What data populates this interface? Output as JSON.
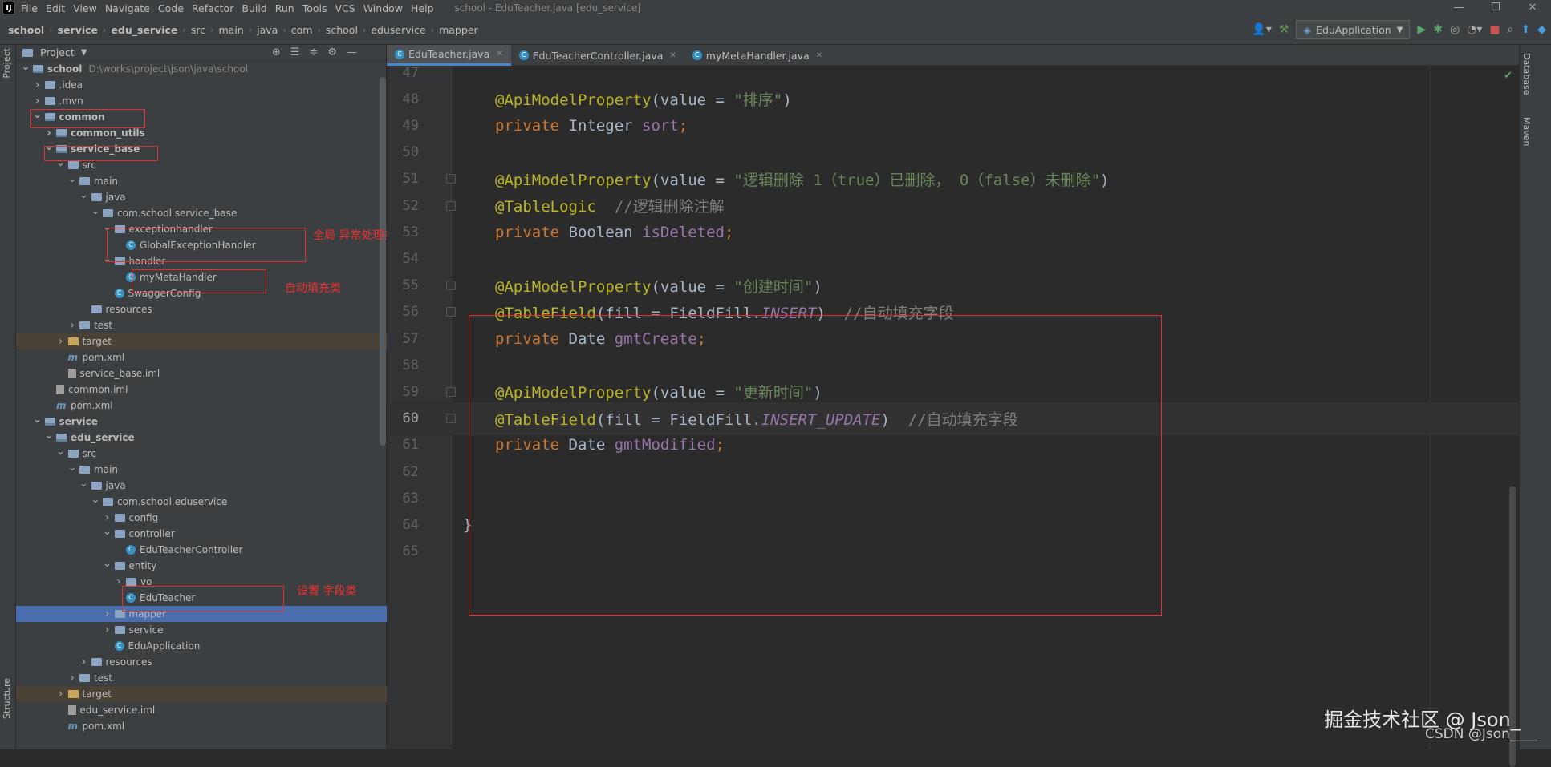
{
  "menubar": {
    "logo": "IJ",
    "items": [
      "File",
      "Edit",
      "View",
      "Navigate",
      "Code",
      "Refactor",
      "Build",
      "Run",
      "Tools",
      "VCS",
      "Window",
      "Help"
    ],
    "title": "school - EduTeacher.java [edu_service]",
    "controls": [
      "—",
      "❐",
      "✕"
    ]
  },
  "breadcrumb": [
    "school",
    "service",
    "edu_service",
    "src",
    "main",
    "java",
    "com",
    "school",
    "eduservice",
    "mapper"
  ],
  "toolbar": {
    "run_config": "EduApplication"
  },
  "leftstrip": {
    "project": "Project",
    "structure": "Structure"
  },
  "rightstrip": {
    "database": "Database",
    "maven": "Maven"
  },
  "project": {
    "title": "Project",
    "tree": [
      {
        "label": "school",
        "path": "D:\\works\\project\\json\\java\\school",
        "depth": 0,
        "arrow": "v",
        "icon": "module",
        "bold": true
      },
      {
        "label": ".idea",
        "depth": 1,
        "arrow": ">",
        "icon": "folder"
      },
      {
        "label": ".mvn",
        "depth": 1,
        "arrow": ">",
        "icon": "folder"
      },
      {
        "label": "common",
        "depth": 1,
        "arrow": "v",
        "icon": "module",
        "bold": true
      },
      {
        "label": "common_utils",
        "depth": 2,
        "arrow": ">",
        "icon": "module",
        "bold": true
      },
      {
        "label": "service_base",
        "depth": 2,
        "arrow": "v",
        "icon": "module",
        "bold": true
      },
      {
        "label": "src",
        "depth": 3,
        "arrow": "v",
        "icon": "folder"
      },
      {
        "label": "main",
        "depth": 4,
        "arrow": "v",
        "icon": "folder"
      },
      {
        "label": "java",
        "depth": 5,
        "arrow": "v",
        "icon": "folder"
      },
      {
        "label": "com.school.service_base",
        "depth": 6,
        "arrow": "v",
        "icon": "folder"
      },
      {
        "label": "exceptionhandler",
        "depth": 7,
        "arrow": "v",
        "icon": "folder"
      },
      {
        "label": "GlobalExceptionHandler",
        "depth": 8,
        "arrow": "",
        "icon": "class"
      },
      {
        "label": "handler",
        "depth": 7,
        "arrow": "v",
        "icon": "folder"
      },
      {
        "label": "myMetaHandler",
        "depth": 8,
        "arrow": "",
        "icon": "class"
      },
      {
        "label": "SwaggerConfig",
        "depth": 7,
        "arrow": "",
        "icon": "class"
      },
      {
        "label": "resources",
        "depth": 5,
        "arrow": "",
        "icon": "folder"
      },
      {
        "label": "test",
        "depth": 4,
        "arrow": ">",
        "icon": "folder"
      },
      {
        "label": "target",
        "depth": 3,
        "arrow": ">",
        "icon": "folder-orange",
        "excluded": true
      },
      {
        "label": "pom.xml",
        "depth": 3,
        "arrow": "",
        "icon": "maven"
      },
      {
        "label": "service_base.iml",
        "depth": 3,
        "arrow": "",
        "icon": "iml"
      },
      {
        "label": "common.iml",
        "depth": 2,
        "arrow": "",
        "icon": "iml"
      },
      {
        "label": "pom.xml",
        "depth": 2,
        "arrow": "",
        "icon": "maven"
      },
      {
        "label": "service",
        "depth": 1,
        "arrow": "v",
        "icon": "module",
        "bold": true
      },
      {
        "label": "edu_service",
        "depth": 2,
        "arrow": "v",
        "icon": "module",
        "bold": true
      },
      {
        "label": "src",
        "depth": 3,
        "arrow": "v",
        "icon": "folder"
      },
      {
        "label": "main",
        "depth": 4,
        "arrow": "v",
        "icon": "folder"
      },
      {
        "label": "java",
        "depth": 5,
        "arrow": "v",
        "icon": "folder"
      },
      {
        "label": "com.school.eduservice",
        "depth": 6,
        "arrow": "v",
        "icon": "folder"
      },
      {
        "label": "config",
        "depth": 7,
        "arrow": ">",
        "icon": "folder"
      },
      {
        "label": "controller",
        "depth": 7,
        "arrow": "v",
        "icon": "folder"
      },
      {
        "label": "EduTeacherController",
        "depth": 8,
        "arrow": "",
        "icon": "class"
      },
      {
        "label": "entity",
        "depth": 7,
        "arrow": "v",
        "icon": "folder"
      },
      {
        "label": "vo",
        "depth": 8,
        "arrow": ">",
        "icon": "folder"
      },
      {
        "label": "EduTeacher",
        "depth": 8,
        "arrow": "",
        "icon": "class"
      },
      {
        "label": "mapper",
        "depth": 7,
        "arrow": ">",
        "icon": "folder",
        "selected": true
      },
      {
        "label": "service",
        "depth": 7,
        "arrow": ">",
        "icon": "folder"
      },
      {
        "label": "EduApplication",
        "depth": 7,
        "arrow": "",
        "icon": "class"
      },
      {
        "label": "resources",
        "depth": 5,
        "arrow": ">",
        "icon": "folder"
      },
      {
        "label": "test",
        "depth": 4,
        "arrow": ">",
        "icon": "folder"
      },
      {
        "label": "target",
        "depth": 3,
        "arrow": ">",
        "icon": "folder-orange",
        "excluded": true
      },
      {
        "label": "edu_service.iml",
        "depth": 3,
        "arrow": "",
        "icon": "iml"
      },
      {
        "label": "pom.xml",
        "depth": 3,
        "arrow": "",
        "icon": "maven"
      }
    ]
  },
  "annotations": {
    "global_exception": "全局 异常处理类",
    "auto_fill": "自动填充类",
    "set_field": "设置 字段类"
  },
  "tabs": [
    "EduTeacher.java",
    "EduTeacherController.java",
    "myMetaHandler.java"
  ],
  "editor": {
    "current_line": "60",
    "lines": [
      {
        "n": "47",
        "tokens": []
      },
      {
        "n": "48",
        "tokens": [
          [
            "ann",
            "@ApiModelProperty"
          ],
          [
            "pl",
            "(value = "
          ],
          [
            "str",
            "\"排序\""
          ],
          [
            "pl",
            ")"
          ]
        ]
      },
      {
        "n": "49",
        "tokens": [
          [
            "kw",
            "private "
          ],
          [
            "pl",
            "Integer "
          ],
          [
            "fld",
            "sort"
          ],
          [
            "kw",
            ";"
          ]
        ]
      },
      {
        "n": "50",
        "tokens": []
      },
      {
        "n": "51",
        "tokens": [
          [
            "ann",
            "@ApiModelProperty"
          ],
          [
            "pl",
            "(value = "
          ],
          [
            "str",
            "\"逻辑删除 1（true）已删除， 0（false）未删除\""
          ],
          [
            "pl",
            ")"
          ]
        ]
      },
      {
        "n": "52",
        "tokens": [
          [
            "ann",
            "@TableLogic"
          ],
          [
            "cmt",
            "  //逻辑删除注解"
          ]
        ]
      },
      {
        "n": "53",
        "tokens": [
          [
            "kw",
            "private "
          ],
          [
            "pl",
            "Boolean "
          ],
          [
            "fld",
            "isDeleted"
          ],
          [
            "kw",
            ";"
          ]
        ]
      },
      {
        "n": "54",
        "tokens": []
      },
      {
        "n": "55",
        "tokens": [
          [
            "ann",
            "@ApiModelProperty"
          ],
          [
            "pl",
            "(value = "
          ],
          [
            "str",
            "\"创建时间\""
          ],
          [
            "pl",
            ")"
          ]
        ]
      },
      {
        "n": "56",
        "tokens": [
          [
            "ann",
            "@TableField"
          ],
          [
            "pl",
            "(fill = FieldFill."
          ],
          [
            "fldi",
            "INSERT"
          ],
          [
            "pl",
            ")"
          ],
          [
            "cmt",
            "  //自动填充字段"
          ]
        ]
      },
      {
        "n": "57",
        "tokens": [
          [
            "kw",
            "private "
          ],
          [
            "pl",
            "Date "
          ],
          [
            "fld",
            "gmtCreate"
          ],
          [
            "kw",
            ";"
          ]
        ]
      },
      {
        "n": "58",
        "tokens": []
      },
      {
        "n": "59",
        "tokens": [
          [
            "ann",
            "@ApiModelProperty"
          ],
          [
            "pl",
            "(value = "
          ],
          [
            "str",
            "\"更新时间\""
          ],
          [
            "pl",
            ")"
          ]
        ]
      },
      {
        "n": "60",
        "tokens": [
          [
            "ann",
            "@TableField"
          ],
          [
            "pl",
            "(fill = FieldFill."
          ],
          [
            "fldi",
            "INSERT_UPDATE"
          ],
          [
            "pl",
            ")"
          ],
          [
            "cmt",
            "  //自动填充字段"
          ]
        ]
      },
      {
        "n": "61",
        "tokens": [
          [
            "kw",
            "private "
          ],
          [
            "pl",
            "Date "
          ],
          [
            "fld",
            "gmtModified"
          ],
          [
            "kw",
            ";"
          ]
        ]
      },
      {
        "n": "62",
        "tokens": []
      },
      {
        "n": "63",
        "tokens": []
      },
      {
        "n": "64",
        "tokens": [
          [
            "pl",
            "}"
          ]
        ]
      },
      {
        "n": "65",
        "tokens": []
      }
    ]
  },
  "watermark": {
    "main": "掘金技术社区 @ Json_",
    "sub": "CSDN @Json____"
  }
}
